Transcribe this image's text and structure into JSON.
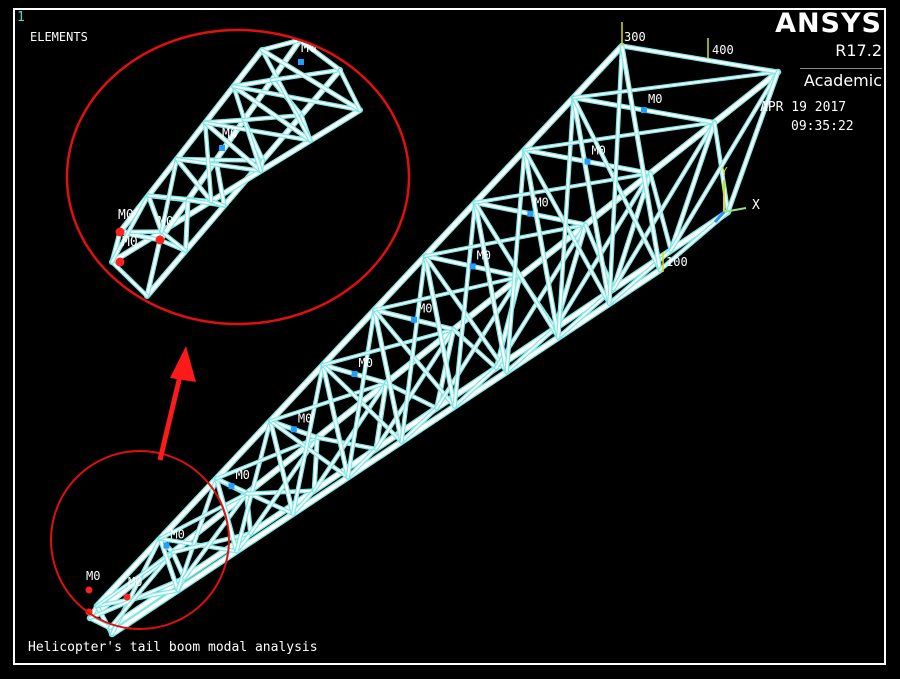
{
  "window": {
    "number": "1",
    "plot_type": "ELEMENTS"
  },
  "branding": {
    "product": "ANSYS",
    "release": "R17.2",
    "edition": "Academic"
  },
  "timestamp": {
    "date": "APR 19 2017",
    "time": "09:35:22"
  },
  "node_labels": {
    "n300": "300",
    "n400": "400",
    "n100": "100"
  },
  "mass_label": "M0",
  "axis": {
    "x": "X",
    "y": "Y"
  },
  "caption": "Helicopter's tail boom modal analysis",
  "colors": {
    "background": "#000000",
    "truss": "#ffffff",
    "edge": "#7fe8e8",
    "mass": "#1fa0ff",
    "fixed": "#ff2020",
    "callout": "#e01010"
  }
}
